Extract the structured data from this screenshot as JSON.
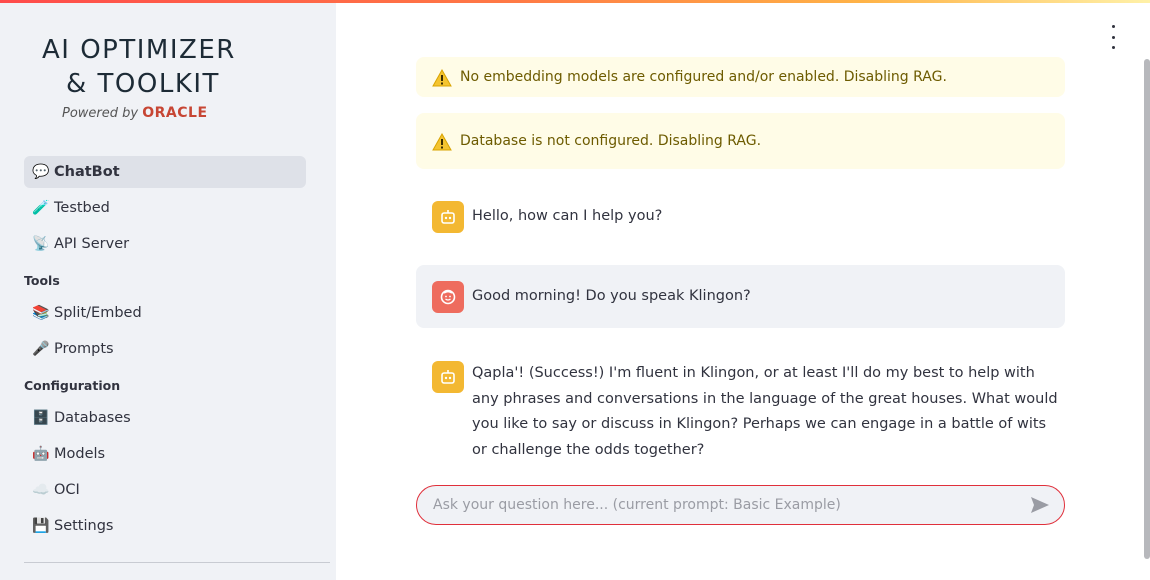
{
  "sidebar": {
    "logo": {
      "line1": "AI OPTIMIZER",
      "line2": "& TOOLKIT",
      "powered_by": "Powered by",
      "brand": "ORACLE"
    },
    "nav": [
      {
        "icon": "💬",
        "label": "ChatBot",
        "active": true
      },
      {
        "icon": "🧪",
        "label": "Testbed"
      },
      {
        "icon": "📡",
        "label": "API Server"
      }
    ],
    "sections": {
      "tools": "Tools",
      "configuration": "Configuration"
    },
    "tools": [
      {
        "icon": "📚",
        "label": "Split/Embed"
      },
      {
        "icon": "🎤",
        "label": "Prompts"
      }
    ],
    "configuration": [
      {
        "icon": "🗄️",
        "label": "Databases"
      },
      {
        "icon": "🤖",
        "label": "Models"
      },
      {
        "icon": "☁️",
        "label": "OCI"
      },
      {
        "icon": "💾",
        "label": "Settings"
      }
    ]
  },
  "alerts": [
    {
      "text": "No embedding models are configured and/or enabled. Disabling RAG."
    },
    {
      "text": "Database is not configured. Disabling RAG."
    }
  ],
  "messages": [
    {
      "role": "assistant",
      "text": "Hello, how can I help you?"
    },
    {
      "role": "user",
      "text": "Good morning! Do you speak Klingon?"
    },
    {
      "role": "assistant",
      "text": "Qapla'! (Success!) I'm fluent in Klingon, or at least I'll do my best to help with any phrases and conversations in the language of the great houses. What would you like to say or discuss in Klingon? Perhaps we can engage in a battle of wits or challenge the odds together?"
    }
  ],
  "chat_input": {
    "placeholder": "Ask your question here... (current prompt: Basic Example)",
    "value": ""
  },
  "colors": {
    "accent": "#ff4b4b",
    "bot_avatar": "#f3b832",
    "user_avatar": "#ee6c5e",
    "warning_bg": "#fffce7",
    "warning_text": "#6d5b00"
  }
}
